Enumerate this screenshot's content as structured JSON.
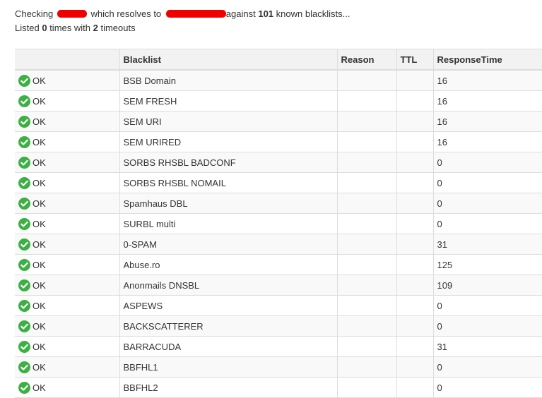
{
  "summary": {
    "checking_label": "Checking",
    "resolves_text": "which resolves to",
    "against_text": "against",
    "blacklist_count": "101",
    "known_text": "known blacklists...",
    "listed_label": "Listed",
    "listed_count": "0",
    "times_text": "times with",
    "timeouts_count": "2",
    "timeouts_label": "timeouts"
  },
  "table": {
    "headers": [
      "",
      "Blacklist",
      "Reason",
      "TTL",
      "ResponseTime"
    ],
    "rows": [
      {
        "status": "OK",
        "blacklist": "BSB Domain",
        "reason": "",
        "ttl": "",
        "response_time": "16"
      },
      {
        "status": "OK",
        "blacklist": "SEM FRESH",
        "reason": "",
        "ttl": "",
        "response_time": "16"
      },
      {
        "status": "OK",
        "blacklist": "SEM URI",
        "reason": "",
        "ttl": "",
        "response_time": "16"
      },
      {
        "status": "OK",
        "blacklist": "SEM URIRED",
        "reason": "",
        "ttl": "",
        "response_time": "16"
      },
      {
        "status": "OK",
        "blacklist": "SORBS RHSBL BADCONF",
        "reason": "",
        "ttl": "",
        "response_time": "0"
      },
      {
        "status": "OK",
        "blacklist": "SORBS RHSBL NOMAIL",
        "reason": "",
        "ttl": "",
        "response_time": "0"
      },
      {
        "status": "OK",
        "blacklist": "Spamhaus DBL",
        "reason": "",
        "ttl": "",
        "response_time": "0"
      },
      {
        "status": "OK",
        "blacklist": "SURBL multi",
        "reason": "",
        "ttl": "",
        "response_time": "0"
      },
      {
        "status": "OK",
        "blacklist": "0-SPAM",
        "reason": "",
        "ttl": "",
        "response_time": "31"
      },
      {
        "status": "OK",
        "blacklist": "Abuse.ro",
        "reason": "",
        "ttl": "",
        "response_time": "125"
      },
      {
        "status": "OK",
        "blacklist": "Anonmails DNSBL",
        "reason": "",
        "ttl": "",
        "response_time": "109"
      },
      {
        "status": "OK",
        "blacklist": "ASPEWS",
        "reason": "",
        "ttl": "",
        "response_time": "0"
      },
      {
        "status": "OK",
        "blacklist": "BACKSCATTERER",
        "reason": "",
        "ttl": "",
        "response_time": "0"
      },
      {
        "status": "OK",
        "blacklist": "BARRACUDA",
        "reason": "",
        "ttl": "",
        "response_time": "31"
      },
      {
        "status": "OK",
        "blacklist": "BBFHL1",
        "reason": "",
        "ttl": "",
        "response_time": "0"
      },
      {
        "status": "OK",
        "blacklist": "BBFHL2",
        "reason": "",
        "ttl": "",
        "response_time": "0"
      }
    ]
  },
  "icons": {
    "ok": "check-circle-icon"
  },
  "colors": {
    "ok_green": "#3cb043",
    "redaction": "#f00000",
    "text": "#333333",
    "border": "#dddddd"
  }
}
